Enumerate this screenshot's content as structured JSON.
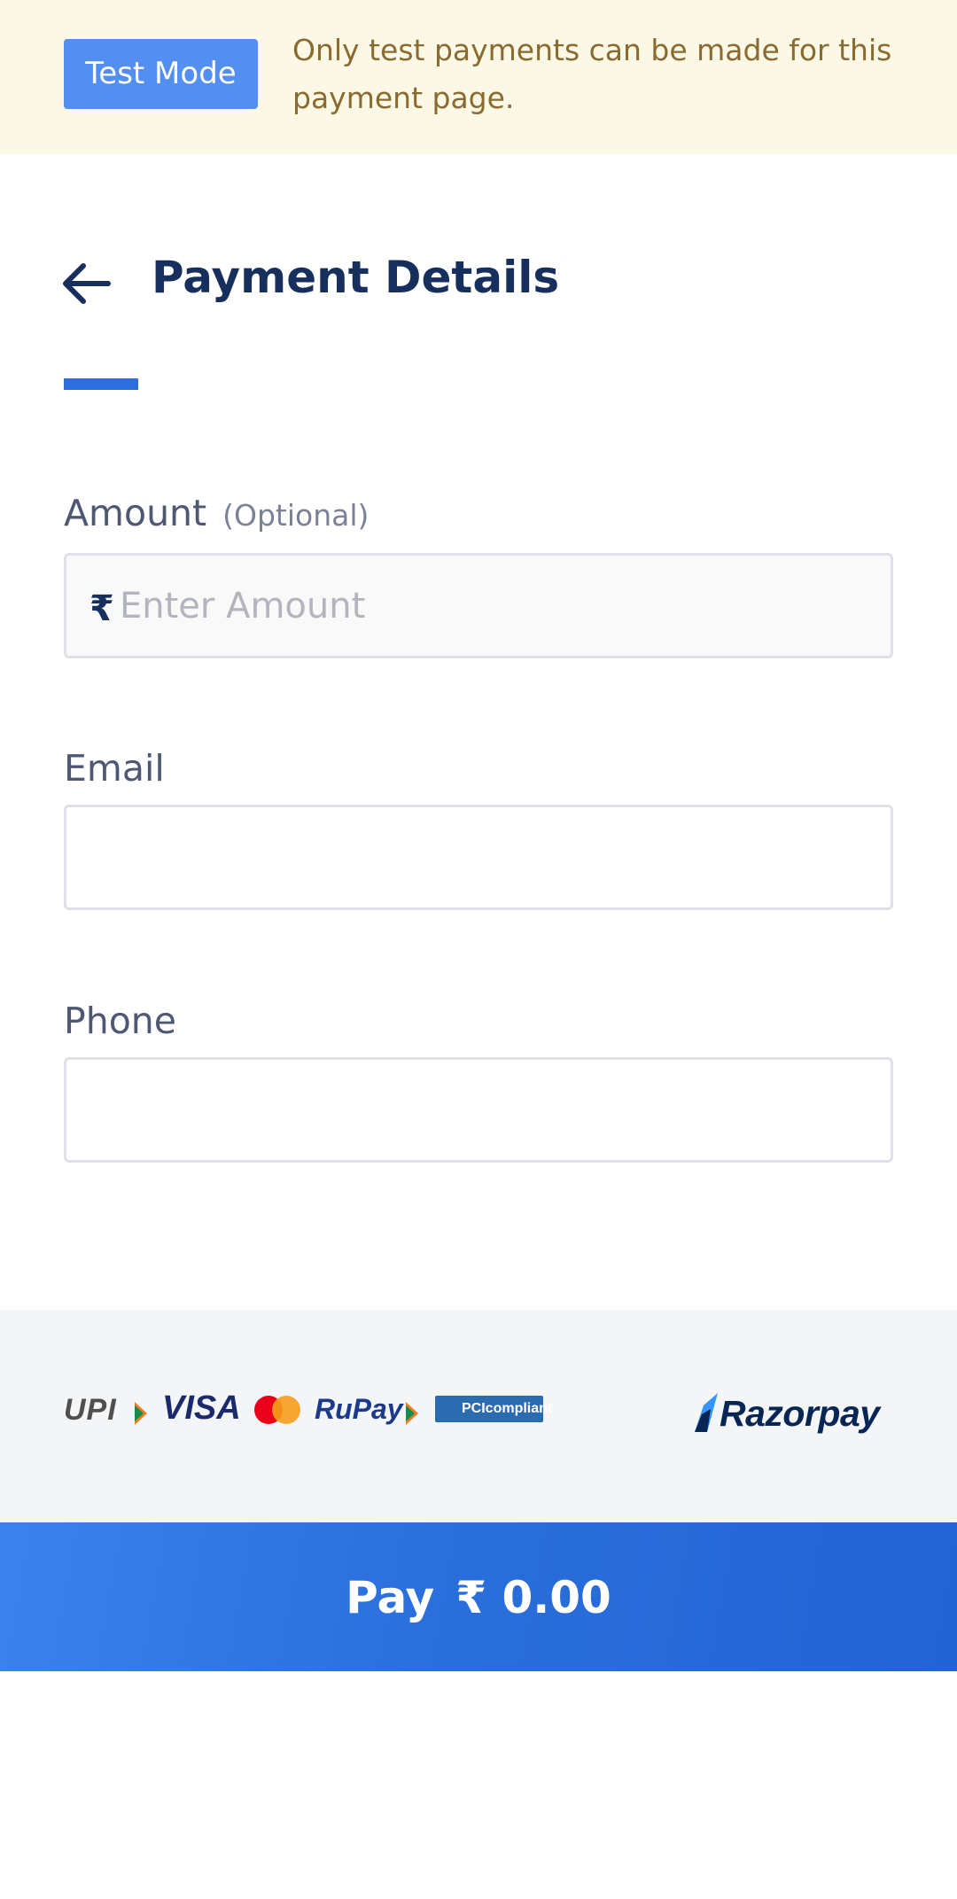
{
  "banner": {
    "badge_label": "Test Mode",
    "message": "Only test payments can be made for this payment page."
  },
  "header": {
    "back_icon": "arrow-left-icon",
    "title": "Payment Details"
  },
  "form": {
    "amount": {
      "label": "Amount",
      "optional_hint": "(Optional)",
      "currency_symbol": "₹",
      "placeholder": "Enter Amount",
      "value": ""
    },
    "email": {
      "label": "Email",
      "value": ""
    },
    "phone": {
      "label": "Phone",
      "value": ""
    }
  },
  "footer": {
    "payment_logos": [
      "UPI",
      "VISA",
      "mastercard-icon",
      "RuPay",
      "PCIcompliant"
    ],
    "upi_text": "UPI",
    "visa_text": "VISA",
    "rupay_text": "RuPay",
    "pci_text": "PCIcompliant",
    "brand": "Razorpay"
  },
  "pay_button": {
    "label": "Pay",
    "currency_symbol": "₹",
    "amount": "0.00"
  },
  "colors": {
    "banner_bg": "#fcf8e6",
    "badge_bg": "#528ff0",
    "title": "#162f5c",
    "accent": "#2f6ee0",
    "pay_button": "#2a6fdc"
  }
}
